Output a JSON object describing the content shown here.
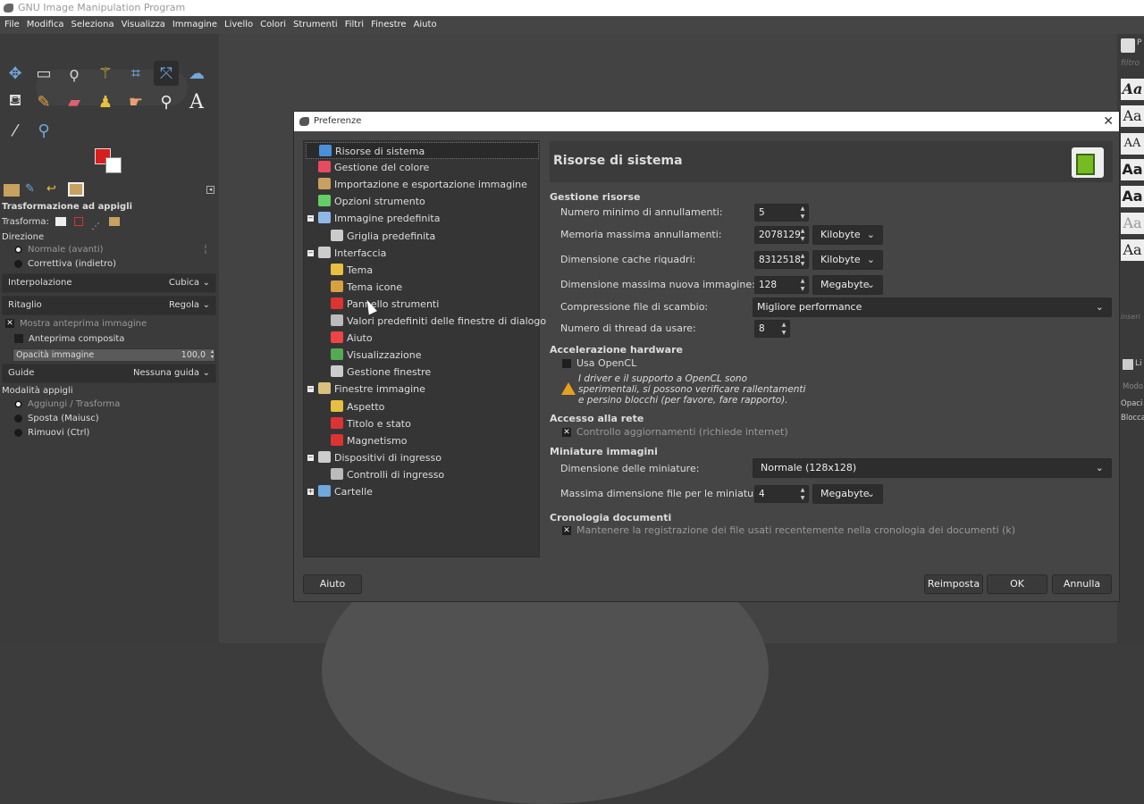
{
  "app": {
    "title": "GNU Image Manipulation Program"
  },
  "menubar": [
    "File",
    "Modifica",
    "Seleziona",
    "Visualizza",
    "Immagine",
    "Livello",
    "Colori",
    "Strumenti",
    "Filtri",
    "Finestre",
    "Aiuto"
  ],
  "colors": {
    "foreground": "#d91e1e",
    "background": "#ffffff",
    "accent": "#6fa8dc",
    "warning": "#e8a020"
  },
  "toolbox": {
    "tools": [
      "move-icon",
      "rect-select-icon",
      "lasso-icon",
      "fuzzy-select-icon",
      "crop-icon",
      "unified-transform-icon",
      "warp-icon",
      "bucket-fill-icon",
      "paintbrush-icon",
      "eraser-icon",
      "clone-icon",
      "smudge-icon",
      "paths-icon",
      "text-icon",
      "color-picker-icon",
      "zoom-icon"
    ],
    "tool_options_title": "Trasformazione ad appigli",
    "trasforma_label": "Trasforma:",
    "direzione_label": "Direzione",
    "direzione_options": [
      "Normale (avanti)",
      "Correttiva (indietro)"
    ],
    "interpolazione_label": "Interpolazione",
    "interpolazione_value": "Cubica",
    "ritaglio_label": "Ritaglio",
    "ritaglio_value": "Regola",
    "mostra_anteprima": "Mostra anteprima immagine",
    "anteprima_composita": "Anteprima composita",
    "opacita_label": "Opacità immagine",
    "opacita_value": "100,0",
    "guide_label": "Guide",
    "guide_value": "Nessuna guida",
    "modalita_label": "Modalità appigli",
    "modalita_options": [
      "Aggiungi / Trasforma",
      "Sposta (Maiusc)",
      "Rimuovi (Ctrl)"
    ]
  },
  "rightdock": {
    "filter_placeholder": "filtro",
    "fonts": [
      "Aa",
      "Aa",
      "AA",
      "Aa",
      "Aa",
      "Aa",
      "Aa"
    ],
    "labels": [
      "inseri",
      "Li",
      "Modo",
      "Opaci",
      "Blocca"
    ]
  },
  "dialog": {
    "title": "Preferenze",
    "tree": [
      {
        "label": "Risorse di sistema",
        "level": 0,
        "selected": true
      },
      {
        "label": "Gestione del colore",
        "level": 0
      },
      {
        "label": "Importazione e esportazione immagine",
        "level": 0
      },
      {
        "label": "Opzioni strumento",
        "level": 0
      },
      {
        "label": "Immagine predefinita",
        "level": 0,
        "expander": "−"
      },
      {
        "label": "Griglia predefinita",
        "level": 1
      },
      {
        "label": "Interfaccia",
        "level": 0,
        "expander": "−"
      },
      {
        "label": "Tema",
        "level": 1
      },
      {
        "label": "Tema icone",
        "level": 1
      },
      {
        "label": "Pannello strumenti",
        "level": 1
      },
      {
        "label": "Valori predefiniti delle finestre di dialogo",
        "level": 1
      },
      {
        "label": "Aiuto",
        "level": 1
      },
      {
        "label": "Visualizzazione",
        "level": 1
      },
      {
        "label": "Gestione finestre",
        "level": 1
      },
      {
        "label": "Finestre immagine",
        "level": 0,
        "expander": "−"
      },
      {
        "label": "Aspetto",
        "level": 1
      },
      {
        "label": "Titolo e stato",
        "level": 1
      },
      {
        "label": "Magnetismo",
        "level": 1
      },
      {
        "label": "Dispositivi di ingresso",
        "level": 0,
        "expander": "−"
      },
      {
        "label": "Controlli di ingresso",
        "level": 1
      },
      {
        "label": "Cartelle",
        "level": 0,
        "expander": "+"
      }
    ],
    "panel_title": "Risorse di sistema",
    "gestione_risorse": {
      "header": "Gestione risorse",
      "min_undo_label": "Numero minimo di annullamenti:",
      "min_undo_value": "5",
      "max_undo_mem_label": "Memoria massima annullamenti:",
      "max_undo_mem_value": "2078129",
      "max_undo_mem_unit": "Kilobyte",
      "cache_label": "Dimensione cache riquadri:",
      "cache_value": "8312518",
      "cache_unit": "Kilobyte",
      "max_new_image_label": "Dimensione massima nuova immagine:",
      "max_new_image_value": "128",
      "max_new_image_unit": "Megabyte",
      "swap_label": "Compressione file di scambio:",
      "swap_value": "Migliore performance",
      "threads_label": "Numero di thread da usare:",
      "threads_value": "8"
    },
    "hardware": {
      "header": "Accelerazione hardware",
      "opencl_label": "Usa OpenCL",
      "opencl_note_1": "I driver e il supporto a OpenCL sono",
      "opencl_note_2": "sperimentali, si possono verificare rallentamenti",
      "opencl_note_3": "e persino blocchi (per favore, fare rapporto)."
    },
    "network": {
      "header": "Accesso alla rete",
      "check_label": "Controllo aggiornamenti (richiede internet)"
    },
    "thumbnails": {
      "header": "Miniature immagini",
      "size_label": "Dimensione delle miniature:",
      "size_value": "Normale (128x128)",
      "max_file_label": "Massima dimensione file per le miniature:",
      "max_file_value": "4",
      "max_file_unit": "Megabyte"
    },
    "history": {
      "header": "Cronologia documenti",
      "check_label": "Mantenere la registrazione dei file usati recentemente nella cronologia dei documenti (k)"
    },
    "buttons": {
      "help": "Aiuto",
      "reset": "Reimposta",
      "ok": "OK",
      "cancel": "Annulla"
    }
  }
}
